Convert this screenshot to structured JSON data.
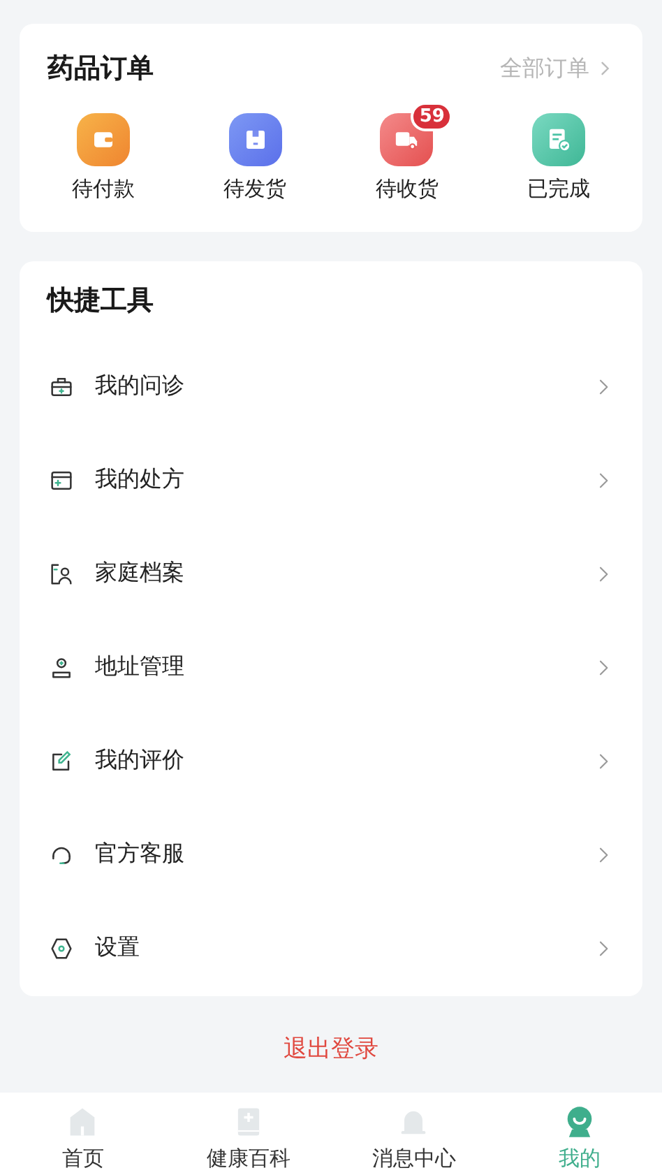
{
  "orders": {
    "title": "药品订单",
    "all_link": "全部订单",
    "items": [
      {
        "kind": "wallet",
        "label": "待付款"
      },
      {
        "kind": "box",
        "label": "待发货"
      },
      {
        "kind": "truck",
        "label": "待收货",
        "badge": "59"
      },
      {
        "kind": "done",
        "label": "已完成"
      }
    ]
  },
  "tools": {
    "title": "快捷工具",
    "items": [
      {
        "kind": "consult",
        "label": "我的问诊"
      },
      {
        "kind": "prescription",
        "label": "我的处方"
      },
      {
        "kind": "family",
        "label": "家庭档案"
      },
      {
        "kind": "address",
        "label": "地址管理"
      },
      {
        "kind": "review",
        "label": "我的评价"
      },
      {
        "kind": "service",
        "label": "官方客服"
      },
      {
        "kind": "settings",
        "label": "设置"
      }
    ]
  },
  "logout": "退出登录",
  "tabs": [
    {
      "kind": "home",
      "label": "首页",
      "selected": false
    },
    {
      "kind": "book",
      "label": "健康百科",
      "selected": false
    },
    {
      "kind": "bell",
      "label": "消息中心",
      "selected": false
    },
    {
      "kind": "me",
      "label": "我的",
      "selected": true
    }
  ]
}
